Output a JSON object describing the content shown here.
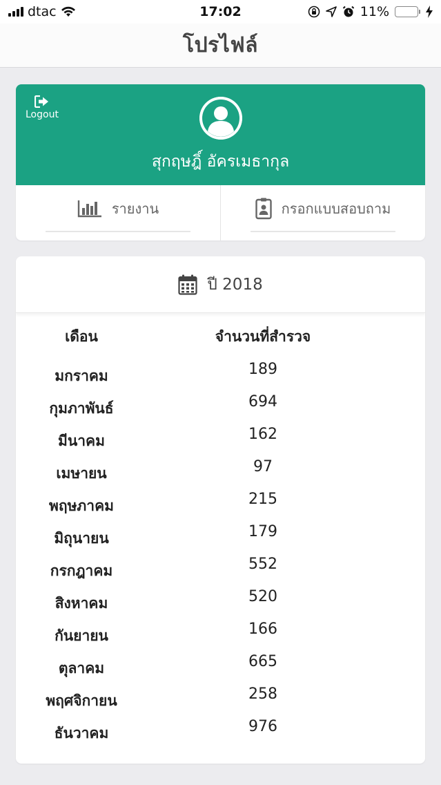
{
  "status_bar": {
    "carrier": "dtac",
    "time": "17:02",
    "battery_percent": "11%",
    "battery_level": 0.11,
    "battery_color": "#e8332c",
    "icons": [
      "signal-icon",
      "wifi-icon",
      "orientation-lock-icon",
      "location-icon",
      "alarm-icon",
      "battery-icon",
      "charging-icon"
    ]
  },
  "nav": {
    "title": "โปรไฟล์"
  },
  "profile": {
    "logout_label": "Logout",
    "name": "สุกฤษฎิ์ อัครเมธากุล",
    "header_color": "#1ba283",
    "actions": [
      {
        "label": "รายงาน",
        "icon": "bar-chart-icon"
      },
      {
        "label": "กรอกแบบสอบถาม",
        "icon": "id-badge-icon"
      }
    ]
  },
  "stats": {
    "year_label": "ปี 2018",
    "icon": "calendar-icon",
    "columns": [
      "เดือน",
      "จำนวนที่สำรวจ"
    ],
    "rows": [
      {
        "month": "มกราคม",
        "count": "189"
      },
      {
        "month": "กุมภาพันธ์",
        "count": "694"
      },
      {
        "month": "มีนาคม",
        "count": "162"
      },
      {
        "month": "เมษายน",
        "count": "97"
      },
      {
        "month": "พฤษภาคม",
        "count": "215"
      },
      {
        "month": "มิถุนายน",
        "count": "179"
      },
      {
        "month": "กรกฎาคม",
        "count": "552"
      },
      {
        "month": "สิงหาคม",
        "count": "520"
      },
      {
        "month": "กันยายน",
        "count": "166"
      },
      {
        "month": "ตุลาคม",
        "count": "665"
      },
      {
        "month": "พฤศจิกายน",
        "count": "258"
      },
      {
        "month": "ธันวาคม",
        "count": "976"
      }
    ]
  }
}
